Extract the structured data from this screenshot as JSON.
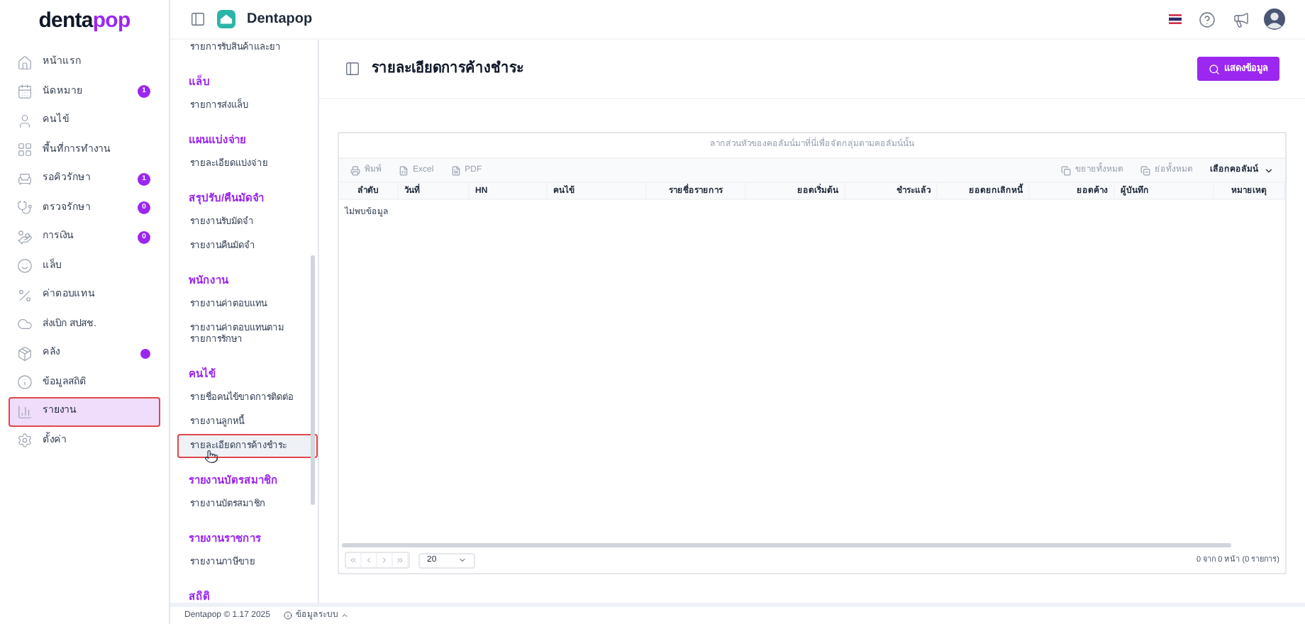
{
  "brand": {
    "dark": "denta",
    "accent": "pop"
  },
  "sidebar": {
    "items": [
      {
        "label": "หน้าแรก",
        "selected": false,
        "dot": false
      },
      {
        "label": "นัดหมาย",
        "selected": false,
        "dot": false,
        "badge": "1"
      },
      {
        "label": "คนไข้",
        "selected": false,
        "dot": false
      },
      {
        "label": "พื้นที่การทำงาน",
        "selected": false,
        "dot": false
      },
      {
        "label": "รอคิวรักษา",
        "selected": false,
        "dot": false,
        "badge": "1"
      },
      {
        "label": "ตรวจรักษา",
        "selected": false,
        "dot": false,
        "badge": "0"
      },
      {
        "label": "การเงิน",
        "selected": false,
        "dot": false,
        "badge": "0"
      },
      {
        "label": "แล็บ",
        "selected": false,
        "dot": false
      },
      {
        "label": "ค่าตอบแทน",
        "selected": false,
        "dot": false
      },
      {
        "label": "ส่งเบิก สปสช.",
        "selected": false,
        "dot": false
      },
      {
        "label": "คลัง",
        "selected": false,
        "dot": true
      },
      {
        "label": "ข้อมูลสถิติ",
        "selected": false,
        "dot": false
      },
      {
        "label": "รายงาน",
        "selected": true,
        "dot": false
      },
      {
        "label": "ตั้งค่า",
        "selected": false,
        "dot": false
      }
    ]
  },
  "topbar": {
    "title": "Dentapop"
  },
  "report_menu": {
    "sections": [
      {
        "items": [
          {
            "label": "รายการรับสินค้าและยา",
            "selected": false
          }
        ]
      },
      {
        "heading": "แล็บ",
        "items": [
          {
            "label": "รายการส่งแล็บ",
            "selected": false
          }
        ]
      },
      {
        "heading": "แผนแบ่งจ่าย",
        "items": [
          {
            "label": "รายละเอียดแบ่งจ่าย",
            "selected": false
          }
        ]
      },
      {
        "heading": "สรุปรับ/คืนมัดจำ",
        "items": [
          {
            "label": "รายงานรับมัดจำ",
            "selected": false
          },
          {
            "label": "รายงานคืนมัดจำ",
            "selected": false
          }
        ]
      },
      {
        "heading": "พนักงาน",
        "items": [
          {
            "label": "รายงานค่าตอบแทน",
            "selected": false
          },
          {
            "label": "รายงานค่าตอบแทนตามรายการรักษา",
            "selected": false
          }
        ]
      },
      {
        "heading": "คนไข้",
        "items": [
          {
            "label": "รายชื่อคนไข้ขาดการติดต่อ",
            "selected": false
          },
          {
            "label": "รายงานลูกหนี้",
            "selected": false
          },
          {
            "label": "รายละเอียดการค้างชำระ",
            "selected": true
          }
        ]
      },
      {
        "heading": "รายงานบัตรสมาชิก",
        "items": [
          {
            "label": "รายงานบัตรสมาชิก",
            "selected": false
          }
        ]
      },
      {
        "heading": "รายงานราชการ",
        "items": [
          {
            "label": "รายงานภาษีขาย",
            "selected": false
          }
        ]
      },
      {
        "heading": "สถิติ"
      }
    ]
  },
  "page": {
    "title": "รายละเอียดการค้างชำระ",
    "button": "แสดงข้อมูล"
  },
  "grid": {
    "group_hint": "ลากส่วนหัวของคอลัมน์มาที่นี่เพื่อจัดกลุ่มตามคอลัมน์นั้น",
    "toolbar_left": [
      {
        "label": "พิมพ์",
        "disabled": true
      },
      {
        "label": "Excel",
        "disabled": true
      },
      {
        "label": "PDF",
        "disabled": true
      }
    ],
    "toolbar_right": [
      {
        "label": "ขยายทั้งหมด",
        "disabled": true
      },
      {
        "label": "ย่อทั้งหมด",
        "disabled": true
      }
    ],
    "column_chooser": "เลือกคอลัมน์",
    "columns": [
      {
        "label": "ลำดับ"
      },
      {
        "label": "วันที่"
      },
      {
        "label": "HN"
      },
      {
        "label": "คนไข้"
      },
      {
        "label": "รายชื่อรายการ"
      },
      {
        "label": "ยอดเริ่มต้น"
      },
      {
        "label": "ชำระแล้ว"
      },
      {
        "label": "ยอดยกเลิกหนี้"
      },
      {
        "label": "ยอดค้าง"
      },
      {
        "label": "ผู้บันทึก"
      },
      {
        "label": "หมายเหตุ"
      }
    ],
    "empty": "ไม่พบข้อมูล",
    "page_size": "20",
    "pager_info": "0 จาก 0 หน้า (0 รายการ)"
  },
  "footer": {
    "copyright": "Dentapop © 1.17 2025",
    "system_info": "ข้อมูลระบบ"
  }
}
